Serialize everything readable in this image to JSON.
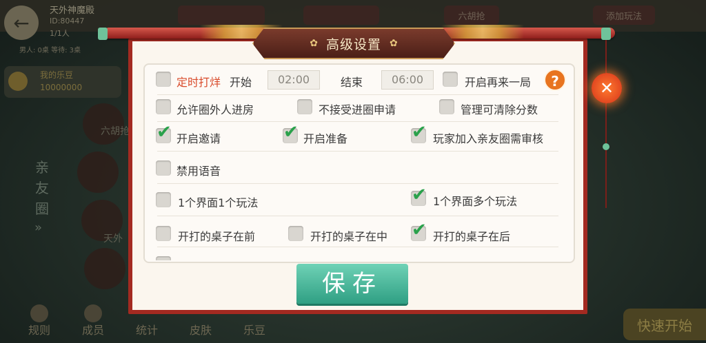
{
  "background": {
    "club_name": "天外神魔殿",
    "club_id": "ID:80447",
    "club_count": "1/1人",
    "club_stats": "男人: 0桌   等待: 3桌",
    "top_pills": [
      "",
      "",
      "六胡抢",
      "添加玩法"
    ],
    "beans_label": "我的乐豆",
    "beans_value": "10000000",
    "side_title": "亲友圈",
    "side_arrow": "»",
    "nav": [
      "规则",
      "成员",
      "统计",
      "皮肤",
      "乐豆"
    ],
    "quick_start": "快速开始",
    "mid_labels": [
      "六胡抢",
      "天外"
    ]
  },
  "modal": {
    "title": "高级设置",
    "row1": {
      "timer_label": "定时打烊",
      "start_label": "开始",
      "start_time": "02:00",
      "end_label": "结束",
      "end_time": "06:00",
      "replay_label": "开启再来一局",
      "help_icon": "?"
    },
    "options": {
      "allow_outsiders": "允许圈外人进房",
      "reject_requests": "不接受进圈申请",
      "manager_clear": "管理可清除分数",
      "enable_invite": "开启邀请",
      "enable_ready": "开启准备",
      "join_review": "玩家加入亲友圈需审核",
      "disable_voice": "禁用语音",
      "one_play": "1个界面1个玩法",
      "multi_play": "1个界面多个玩法",
      "table_front": "开打的桌子在前",
      "table_middle": "开打的桌子在中",
      "table_back": "开打的桌子在后"
    },
    "checked": {
      "timer": false,
      "replay": false,
      "allow_outsiders": false,
      "reject_requests": false,
      "manager_clear": false,
      "enable_invite": true,
      "enable_ready": true,
      "join_review": true,
      "disable_voice": false,
      "one_play": false,
      "multi_play": true,
      "table_front": false,
      "table_middle": false,
      "table_back": true
    },
    "save_label": "保存",
    "close_icon": "✕",
    "check_glyph": "✔"
  },
  "colors": {
    "accent_red": "#d94b2b",
    "save_green": "#2f9f83",
    "check_green": "#2aa14b",
    "frame_red": "#a32a21"
  }
}
